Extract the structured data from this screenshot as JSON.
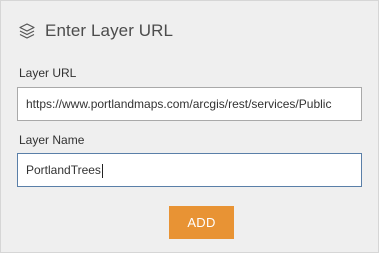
{
  "header": {
    "icon": "layers-icon",
    "title": "Enter Layer URL"
  },
  "form": {
    "layer_url_label": "Layer URL",
    "layer_url_value": "https://www.portlandmaps.com/arcgis/rest/services/Public",
    "layer_name_label": "Layer Name",
    "layer_name_value": "PortlandTrees"
  },
  "actions": {
    "add_label": "ADD"
  },
  "colors": {
    "panel_background": "#efefef",
    "accent": "#e89334",
    "active_border": "#5a7fa8"
  }
}
